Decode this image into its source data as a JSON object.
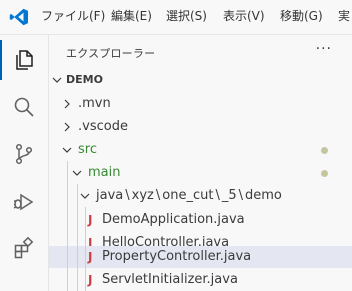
{
  "menu": [
    "ファイル(F)",
    "編集(E)",
    "選択(S)",
    "表示(V)",
    "移動(G)",
    "実"
  ],
  "colors": {
    "accent": "#005fb8",
    "logo": "#0078d4",
    "git_green": "#388a34",
    "java": "#cc3e44",
    "selection": "#e4e6f1"
  },
  "activity_bar": {
    "icons": [
      "explorer-icon",
      "search-icon",
      "source-control-icon",
      "run-debug-icon",
      "extensions-icon"
    ]
  },
  "explorer": {
    "title": "エクスプローラー",
    "more": "···",
    "root": "DEMO",
    "items": {
      "mvn": ".mvn",
      "vscode": ".vscode",
      "src": "src",
      "main": "main",
      "java_path": [
        "java",
        "xyz",
        "one_cut",
        "_5",
        "demo"
      ],
      "files": [
        "DemoApplication.java",
        "HelloController.java",
        "PropertyController.java",
        "ServletInitializer.java"
      ],
      "java_glyph": "J"
    }
  }
}
